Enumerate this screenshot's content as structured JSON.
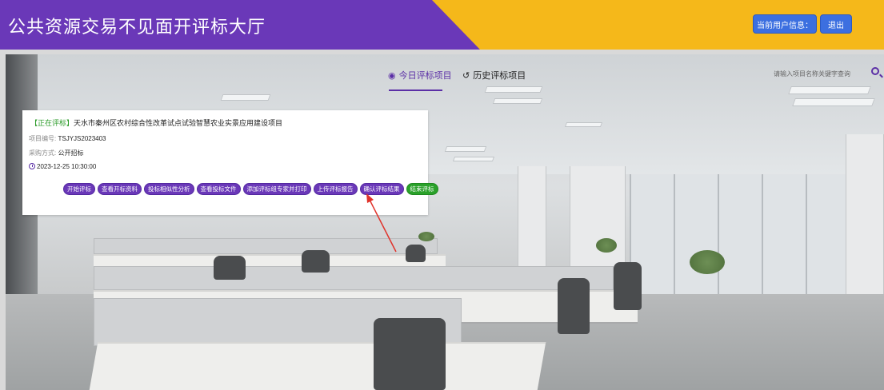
{
  "header": {
    "title": "公共资源交易不见面开评标大厅",
    "user_info_label": "当前用户信息：",
    "logout_label": "退出",
    "colors": {
      "purple": "#6a38b8",
      "yellow": "#f5b81a",
      "button_blue": "#3c6fe0"
    }
  },
  "tabs": [
    {
      "label": "今日评标项目",
      "icon": "user-circle-icon",
      "active": true
    },
    {
      "label": "历史评标项目",
      "icon": "history-icon",
      "active": false
    }
  ],
  "search": {
    "placeholder": "请输入项目名称关键字查询",
    "icon": "search-icon"
  },
  "project_card": {
    "status": "【正在评标】",
    "name": "天水市秦州区农村综合性改革试点试验智慧农业实景应用建设项目",
    "code_label": "项目编号:",
    "code": "TSJYJS2023403",
    "method_label": "采购方式:",
    "method": "公开招标",
    "datetime": "2023-12-25 10:30:00",
    "actions": [
      {
        "label": "开始评标",
        "color": "purple"
      },
      {
        "label": "查看开标资料",
        "color": "purple"
      },
      {
        "label": "投标相似性分析",
        "color": "purple"
      },
      {
        "label": "查看投标文件",
        "color": "purple"
      },
      {
        "label": "添加评标组专家并打印",
        "color": "purple"
      },
      {
        "label": "上传评标报告",
        "color": "purple"
      },
      {
        "label": "确认评标结果",
        "color": "purple"
      },
      {
        "label": "结束评标",
        "color": "green"
      }
    ]
  }
}
